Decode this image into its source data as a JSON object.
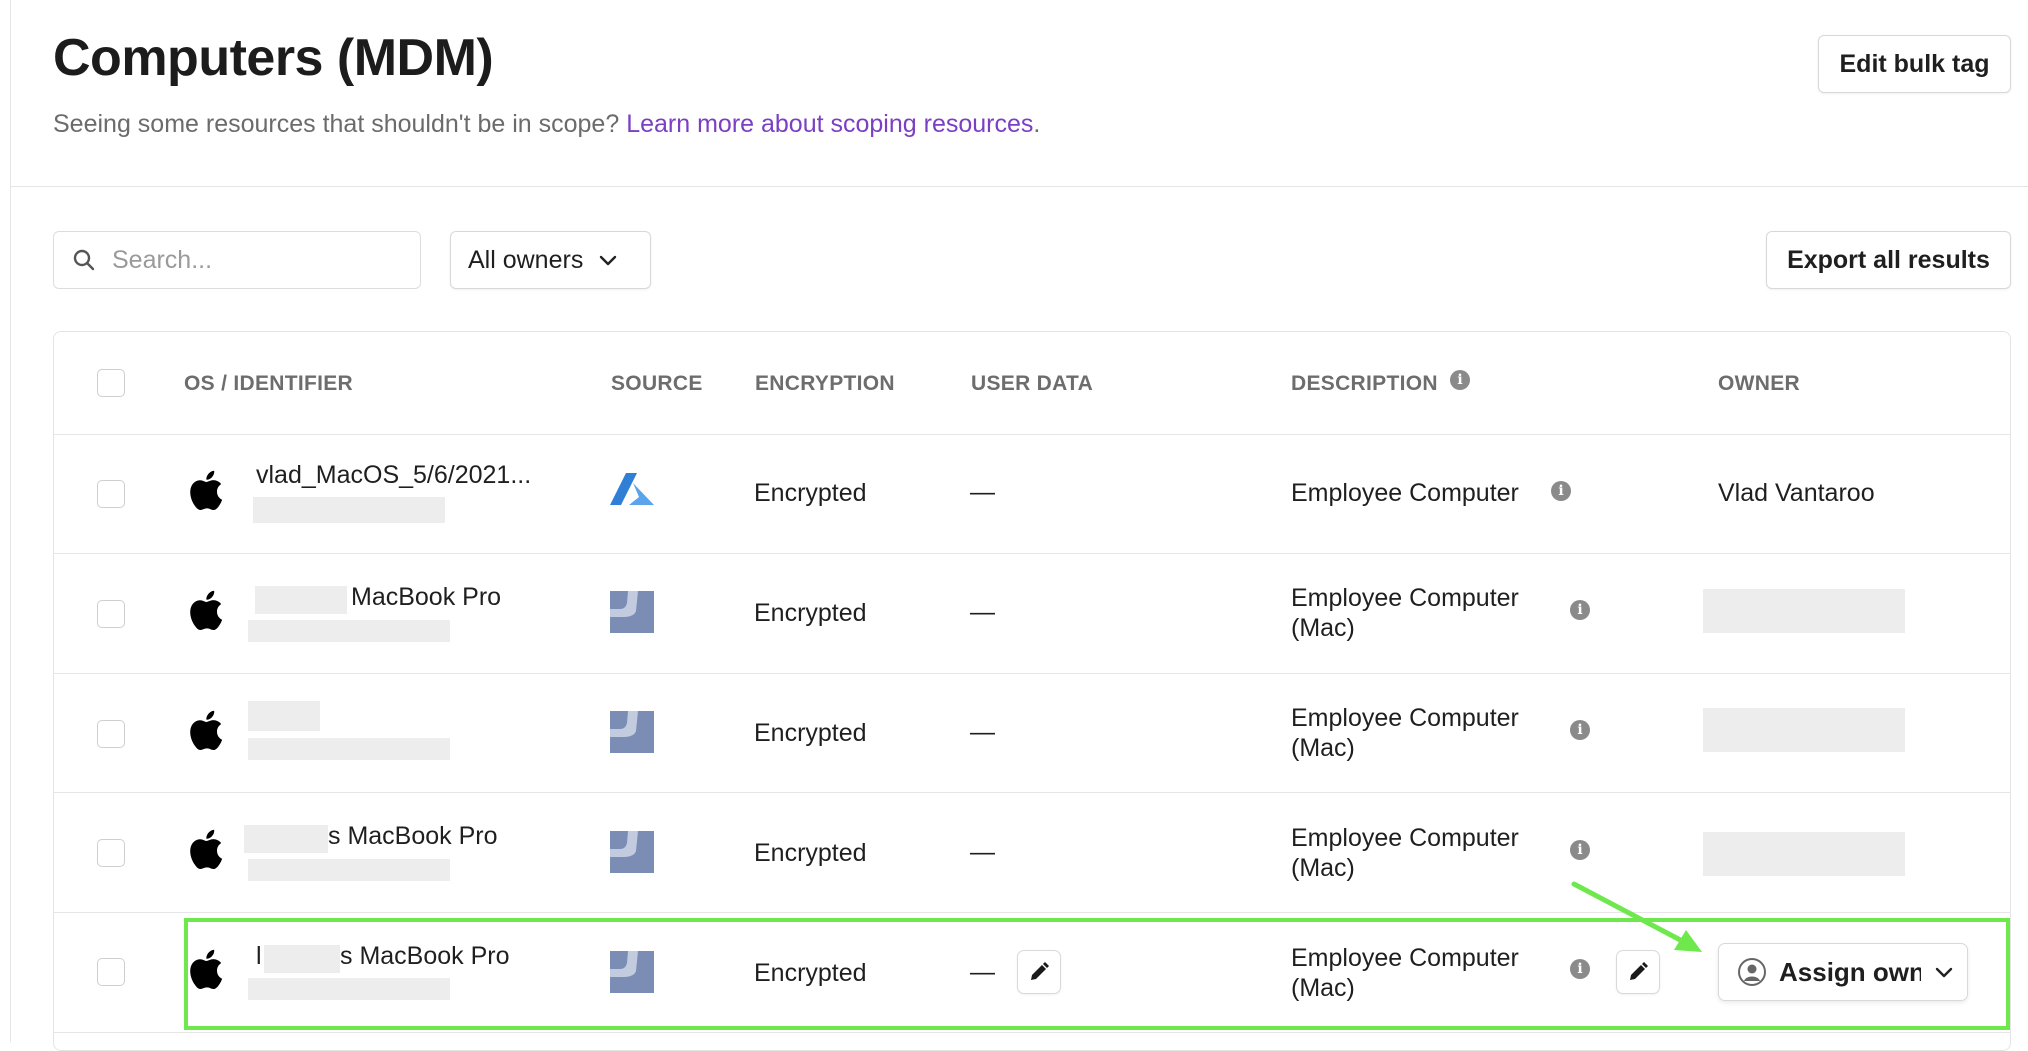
{
  "page": {
    "title": "Computers (MDM)",
    "subtitle_text": "Seeing some resources that shouldn't be in scope?",
    "subtitle_link": "Learn more about scoping resources",
    "subtitle_period": "."
  },
  "toolbar": {
    "edit_bulk_tag": "Edit bulk tag",
    "search_placeholder": "Search...",
    "owner_filter": "All owners",
    "export": "Export all results"
  },
  "table": {
    "columns": [
      "OS / IDENTIFIER",
      "SOURCE",
      "ENCRYPTION",
      "USER DATA",
      "DESCRIPTION",
      "OWNER"
    ],
    "rows": [
      {
        "identifier": "vlad_MacOS_5/6/2021...",
        "source": "azure",
        "encryption": "Encrypted",
        "user_data": "—",
        "description": "Employee Computer",
        "owner": "Vlad Vantaroo"
      },
      {
        "identifier": "MacBook Pro",
        "source": "jamf",
        "encryption": "Encrypted",
        "user_data": "—",
        "description_line1": "Employee Computer",
        "description_line2": "(Mac)",
        "owner": ""
      },
      {
        "identifier": "",
        "source": "jamf",
        "encryption": "Encrypted",
        "user_data": "—",
        "description_line1": "Employee Computer",
        "description_line2": "(Mac)",
        "owner": ""
      },
      {
        "identifier": "s MacBook Pro",
        "source": "jamf",
        "encryption": "Encrypted",
        "user_data": "—",
        "description_line1": "Employee Computer",
        "description_line2": "(Mac)",
        "owner": ""
      },
      {
        "identifier_prefix": "l",
        "identifier": "s MacBook Pro",
        "source": "jamf",
        "encryption": "Encrypted",
        "user_data": "—",
        "description_line1": "Employee Computer",
        "description_line2": "(Mac)",
        "owner_action": "Assign owner"
      }
    ]
  },
  "colors": {
    "link": "#7b3fc4",
    "highlight": "#6ee84d",
    "azure": "#2f7fd6",
    "jamf": "#7b8cb5"
  }
}
